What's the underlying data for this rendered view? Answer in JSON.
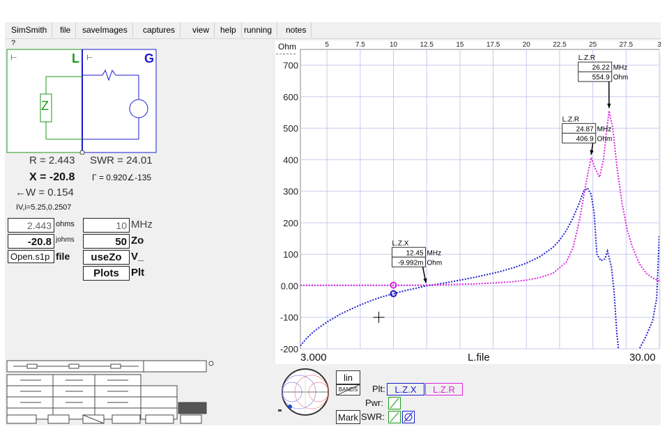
{
  "menu": {
    "items": [
      "SimSmith",
      "file",
      "saveImages",
      "captures",
      "view",
      "help",
      "running",
      "notes"
    ]
  },
  "help_mark": "?",
  "circuit": {
    "left_label": "L",
    "right_label": "G",
    "component_label": "Z",
    "left_color": "#1a9a1a",
    "right_color": "#1a1acc"
  },
  "readouts": {
    "r": "R = 2.443",
    "swr": "SWR = 24.01",
    "x": "X = -20.8",
    "gamma": "Γ = 0.920∠-135",
    "w": "←W = 0.154",
    "vi": "ΙV,i=5.25,0.2507"
  },
  "fields": {
    "r_value": "2.443",
    "r_unit": "ohms",
    "x_value": "-20.8",
    "x_unit": "johms",
    "file_value": "Open.s1p",
    "file_label": "file",
    "freq_value": "10",
    "freq_unit": "MHz",
    "zo_value": "50",
    "zo_label": "Zo",
    "usezo_label": "useZo",
    "v_label": "V_",
    "plots_label": "Plots",
    "plt_label": "Plt"
  },
  "chart_data": {
    "type": "line",
    "y_unit_label": "Ohm",
    "xlabel": "L.file",
    "x_range": [
      3.0,
      30.0
    ],
    "ylim": [
      -200,
      750
    ],
    "x_left_label": "3.000",
    "x_right_label": "30.00",
    "top_ticks": [
      "5",
      "7.5",
      "10",
      "12.5",
      "15",
      "17.5",
      "20",
      "22.5",
      "25",
      "27.5",
      "3"
    ],
    "y_ticks": [
      "700",
      "600",
      "500",
      "400",
      "300",
      "200",
      "100",
      "0.00",
      "-100",
      "-200"
    ],
    "grid": true,
    "series": [
      {
        "name": "L.Z.X",
        "color": "#1a1acc",
        "x": [
          3.0,
          3.5,
          4,
          5,
          6,
          7,
          8,
          9,
          10,
          11,
          12,
          12.45,
          13,
          14,
          15,
          16,
          17,
          18,
          19,
          20,
          21,
          22,
          22.5,
          23,
          23.5,
          24,
          24.3,
          24.6,
          24.87,
          25.1,
          25.3,
          25.6,
          25.9,
          26.1,
          26.4,
          26.6,
          26.8,
          27.0,
          27.5,
          28.0,
          28.5,
          29,
          29.5,
          29.8,
          30.0
        ],
        "y": [
          -190,
          -165,
          -145,
          -115,
          -90,
          -70,
          -52,
          -37,
          -25,
          -14,
          -5,
          0,
          3,
          10,
          18,
          26,
          35,
          45,
          57,
          72,
          92,
          122,
          145,
          175,
          215,
          265,
          300,
          310,
          290,
          230,
          100,
          80,
          85,
          110,
          60,
          -20,
          -150,
          -230,
          -260,
          -240,
          -200,
          -160,
          -110,
          -40,
          160
        ]
      },
      {
        "name": "L.Z.R",
        "color": "#dd22dd",
        "x": [
          3.0,
          4,
          5,
          6,
          7,
          8,
          9,
          10,
          11,
          12,
          13,
          14,
          15,
          16,
          17,
          18,
          19,
          20,
          21,
          22,
          23,
          23.5,
          24,
          24.5,
          24.87,
          25.2,
          25.5,
          25.8,
          26.0,
          26.22,
          26.5,
          26.8,
          27.2,
          27.6,
          28,
          28.5,
          29,
          29.5,
          30.0
        ],
        "y": [
          2,
          2,
          2,
          2,
          2,
          2,
          2,
          2,
          2,
          2,
          3,
          4,
          5,
          6,
          8,
          10,
          13,
          18,
          26,
          40,
          75,
          120,
          210,
          330,
          406.9,
          370,
          345,
          400,
          480,
          554.9,
          500,
          380,
          260,
          175,
          120,
          70,
          40,
          25,
          15
        ]
      }
    ],
    "markers": [
      {
        "name": "L.Z.X",
        "freq": "12.45",
        "freq_unit": "MHz",
        "value": "-9.992m",
        "value_unit": "Ohm",
        "x": 12.45,
        "y": 0
      },
      {
        "name": "L.Z.R",
        "freq": "24.87",
        "freq_unit": "MHz",
        "value": "406.9",
        "value_unit": "Ohm",
        "x": 24.87,
        "y": 406.9
      },
      {
        "name": "L.Z.R",
        "freq": "26.22",
        "freq_unit": "MHz",
        "value": "554.9",
        "value_unit": "Ohm",
        "x": 26.22,
        "y": 554.9
      }
    ],
    "cursor": {
      "x": 10,
      "y": 0
    }
  },
  "controls": {
    "lin_label": "lin",
    "bands_label": "BANDS",
    "mark_label": "Mark",
    "plt_label": "Plt:",
    "pwr_label": "Pwr:",
    "swr_label": "SWR:",
    "legend_x": "L.Z.X",
    "legend_r": "L.Z.R"
  }
}
